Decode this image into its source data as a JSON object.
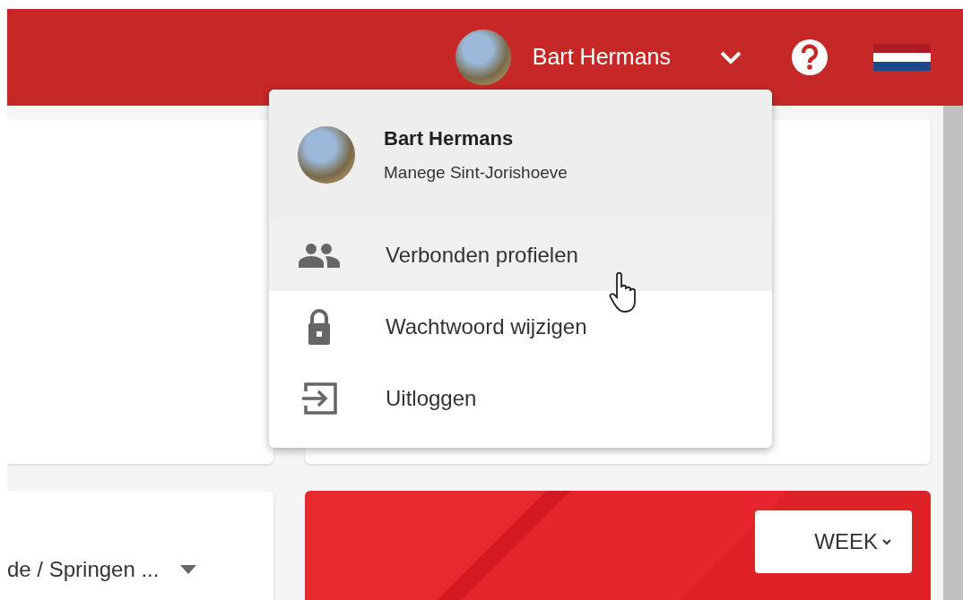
{
  "top_bar": {
    "user_name": "Bart Hermans"
  },
  "user_menu": {
    "expanded": true,
    "name": "Bart Hermans",
    "organization": "Manege Sint-Jorishoeve",
    "items": [
      {
        "kind": "people",
        "label": "Verbonden profielen",
        "hovered": true
      },
      {
        "kind": "lock",
        "label": "Wachtwoord wijzigen",
        "hovered": false
      },
      {
        "kind": "logout",
        "label": "Uitloggen",
        "hovered": false
      }
    ]
  },
  "filter_card": {
    "select_value": "de / Springen ..."
  },
  "chart_card": {
    "period_button": "WEEK"
  }
}
